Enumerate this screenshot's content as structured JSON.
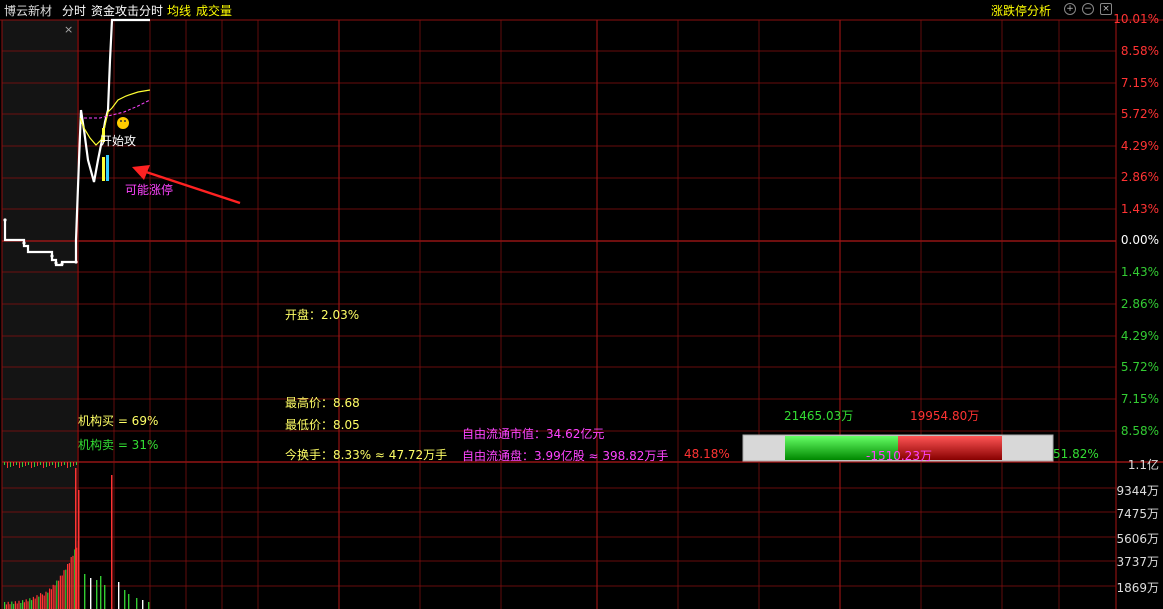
{
  "header": {
    "stock_name": "博云新材",
    "tab_intraday": "分时",
    "indicator_name": "资金攻击分时",
    "avg_line_label": "均线",
    "volume_label": "成交量",
    "limit_analysis_label": "涨跌停分析",
    "colors": {
      "stock_name": "#dddddd",
      "indicator": "#ffffff",
      "avg_line": "#ffff00",
      "volume": "#ffff00",
      "limit_analysis": "#ffff00"
    }
  },
  "window_buttons": {
    "add_icon": "plus-circle-icon",
    "minus_icon": "minus-circle-icon",
    "close_icon": "close-box-icon"
  },
  "price_axis": {
    "up_labels": [
      "10.01%",
      "8.58%",
      "7.15%",
      "5.72%",
      "4.29%",
      "2.86%",
      "1.43%"
    ],
    "zero_label": "0.00%",
    "down_labels": [
      "1.43%",
      "2.86%",
      "4.29%",
      "5.72%",
      "7.15%",
      "8.58%"
    ],
    "colors": {
      "up": "#ff3333",
      "zero": "#ffffff",
      "down": "#33cc33"
    }
  },
  "volume_axis": {
    "labels": [
      "1.1亿",
      "9344万",
      "7475万",
      "5606万",
      "3737万",
      "1869万"
    ],
    "color": "#dddddd"
  },
  "annotations": {
    "start_attack": "开始攻",
    "possible_limit_up": "可能涨停",
    "colors": {
      "start_attack": "#ffffff",
      "possible_limit_up": "#ff44ff",
      "arrow": "#ff2222"
    }
  },
  "stats": {
    "open": "开盘：2.03%",
    "high": "最高价：8.68",
    "low": "最低价：8.05",
    "turnover": "今换手：8.33% ≈ 47.72万手",
    "float_mcap": "自由流通市值：34.62亿元",
    "float_shares": "自由流通盘：3.99亿股 ≈ 398.82万手",
    "inst_buy": "机构买 = 69%",
    "inst_sell": "机构卖 = 31%",
    "colors": {
      "open": "#ffff66",
      "price": "#ffff66",
      "float": "#ff44ff",
      "inst_buy": "#ffff66",
      "inst_sell": "#33dd33"
    }
  },
  "fund_flow": {
    "inflow": "21465.03万",
    "outflow": "19954.80万",
    "net": "-1510.23万",
    "left_pct": "48.18%",
    "right_pct": "51.82%",
    "colors": {
      "inflow": "#33dd33",
      "outflow": "#ff3333",
      "net": "#ff44ff",
      "left_pct": "#ff3333",
      "right_pct": "#33dd33"
    }
  }
}
